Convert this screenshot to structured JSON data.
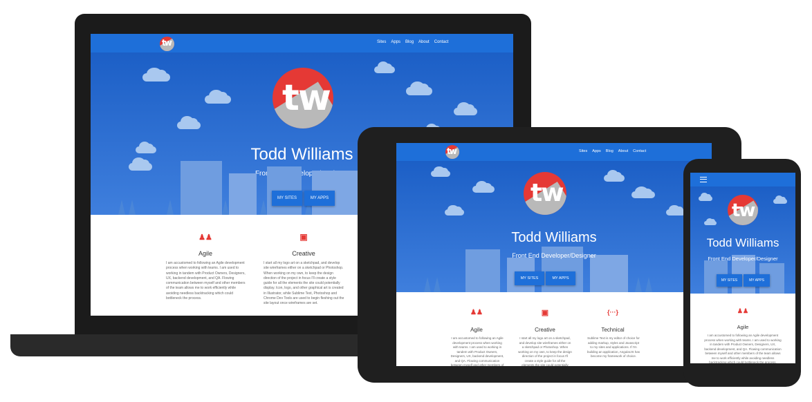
{
  "nav": {
    "links": [
      "Sites",
      "Apps",
      "Blog",
      "About",
      "Contact"
    ]
  },
  "logo": {
    "text": "tw"
  },
  "hero": {
    "name": "Todd Williams",
    "subtitle": "Front End Developer/Designer",
    "btn_sites": "MY SITES",
    "btn_apps": "MY APPS"
  },
  "features": {
    "agile": {
      "icon": "people-icon",
      "title": "Agile",
      "text": "I am accustomed to following an Agile development process when working with teams. I am used to working in tandem with Product Owners, Designers, UX, backend development, and QA. Flowing communication between myself and other members of the team allows me to work efficiently while avoiding needless backtracking which could bottleneck the process."
    },
    "creative": {
      "icon": "layout-icon",
      "title": "Creative",
      "text": "I start all my logo art on a sketchpad, and develop site wireframes either on a sketchpad or Photoshop. When working on my own, to keep the design direction of the project in focus I'll create a style guide for all the elements the site could potentially display. Icon, logo, and other graphical art is created in Illustrator, while Sublime Text, Photoshop and Chrome Dev Tools are used to begin fleshing out the site layout once wireframes are set."
    },
    "technical": {
      "icon": "code-icon",
      "title": "Technical",
      "text": "Sublime Text is my editor of choice for adding markup, styles and Javascript to my sites and applications. If I'm building an application, AngularJS has become my framework of choice."
    }
  },
  "colors": {
    "nav": "#1e6fd9",
    "hero_top": "#1c5fc6",
    "accent_red": "#e53935",
    "device": "#1f1f1f"
  }
}
